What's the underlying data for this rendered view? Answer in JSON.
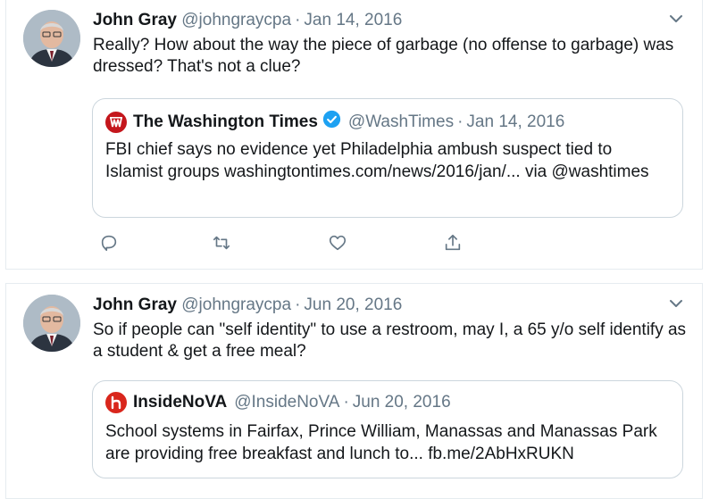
{
  "tweets": [
    {
      "author_name": "John Gray",
      "author_handle": "@johngraycpa",
      "separator": "·",
      "date": "Jan 14, 2016",
      "text": "Really? How about the way the piece of garbage (no offense to garbage) was dressed? That's not a clue?",
      "quote": {
        "name": "The Washington Times",
        "handle": "@WashTimes",
        "separator": "·",
        "date": "Jan 14, 2016",
        "verified": true,
        "logo_color": "#c4161c",
        "text": "FBI chief says no evidence yet Philadelphia ambush suspect tied to Islamist groups washingtontimes.com/news/2016/jan/... via @washtimes"
      }
    },
    {
      "author_name": "John Gray",
      "author_handle": "@johngraycpa",
      "separator": "·",
      "date": "Jun 20, 2016",
      "text": "So if people can \"self identity\" to use a restroom, may I, a 65 y/o self identify as a student & get a free meal?",
      "quote": {
        "name": "InsideNoVA",
        "handle": "@InsideNoVA",
        "separator": "·",
        "date": "Jun 20, 2016",
        "verified": false,
        "logo_color": "#d9261c",
        "text": "School systems in Fairfax, Prince William, Manassas and Manassas Park are providing free breakfast and lunch to... fb.me/2AbHxRUKN"
      }
    }
  ],
  "icons": {
    "actions": [
      "reply-icon",
      "retweet-icon",
      "like-icon",
      "share-icon"
    ],
    "menu": "chevron-down-icon"
  },
  "colors": {
    "secondary_text": "#657786",
    "border": "#ccd6dd",
    "verified_blue": "#1da1f2"
  }
}
